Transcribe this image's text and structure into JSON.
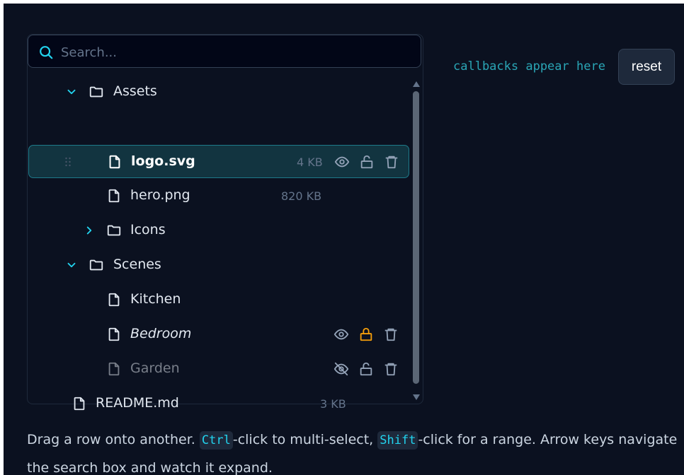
{
  "search": {
    "placeholder": "Search..."
  },
  "tree": {
    "rows": [
      {
        "label": "Assets",
        "type": "folder",
        "expanded": true
      },
      {
        "label": "logo.svg",
        "type": "file",
        "size": "4 KB",
        "selected": true
      },
      {
        "label": "hero.png",
        "type": "file",
        "size": "820 KB"
      },
      {
        "label": "Icons",
        "type": "folder",
        "expanded": false
      },
      {
        "label": "Scenes",
        "type": "folder",
        "expanded": true
      },
      {
        "label": "Kitchen",
        "type": "file"
      },
      {
        "label": "Bedroom",
        "type": "file",
        "locked": true
      },
      {
        "label": "Garden",
        "type": "file",
        "hidden": true
      },
      {
        "label": "README.md",
        "type": "file",
        "size": "3 KB"
      }
    ]
  },
  "callbacks": {
    "text": "callbacks appear here"
  },
  "reset_label": "reset",
  "help": {
    "p1": "Drag a row onto another. ",
    "kbd_ctrl": "Ctrl",
    "p2": "-click to multi-select, ",
    "kbd_shift": "Shift",
    "p3": "-click for a range. Arrow keys navigate",
    "line2": "the search box and watch it expand."
  },
  "colors": {
    "background": "#0b1120",
    "accent": "#22d3ee",
    "selected_row": "#123440",
    "lock_active": "#f59e0b",
    "muted": "#64748b"
  },
  "icons": [
    "search-icon",
    "chevron-down-icon",
    "chevron-right-icon",
    "folder-icon",
    "file-icon",
    "eye-icon",
    "eye-off-icon",
    "unlock-icon",
    "lock-icon",
    "trash-icon",
    "drag-handle-icon"
  ]
}
